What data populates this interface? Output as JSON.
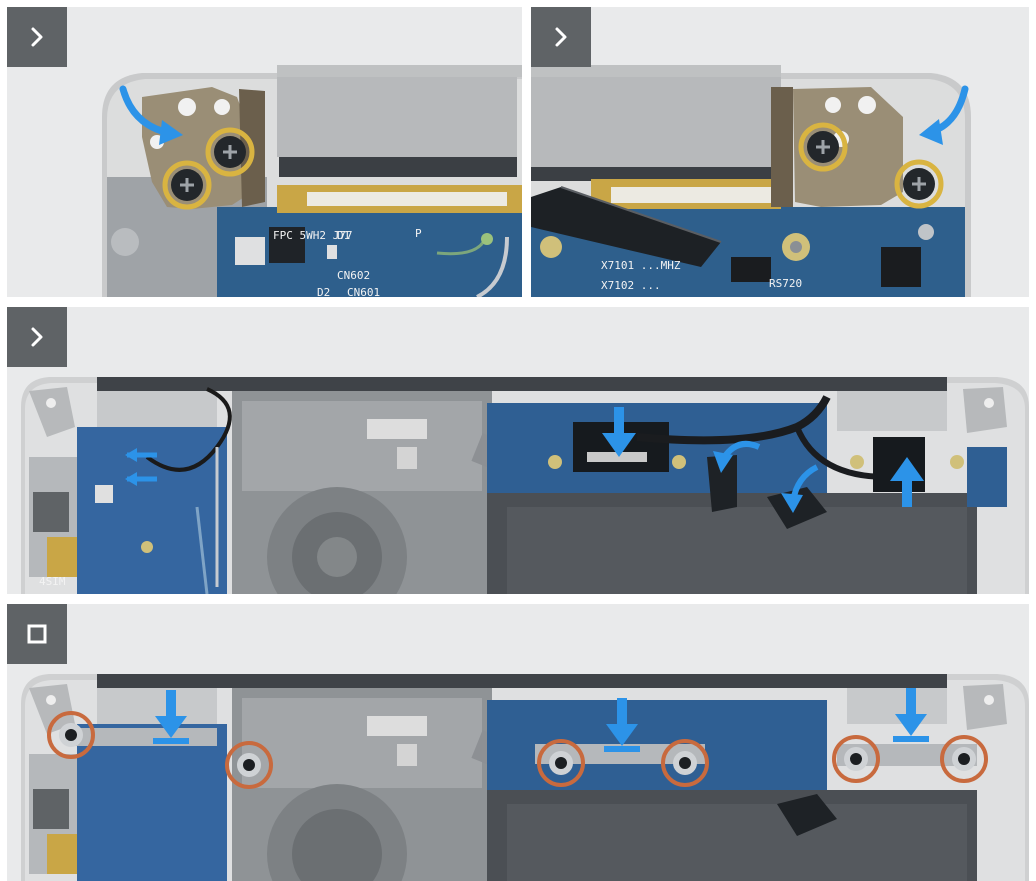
{
  "steps": [
    {
      "badge_icon": "chevron-right-icon"
    },
    {
      "badge_icon": "chevron-right-icon"
    },
    {
      "badge_icon": "chevron-right-icon"
    },
    {
      "badge_icon": "stop-square-icon"
    }
  ],
  "board_labels": {
    "d1": "D1",
    "p": "P",
    "cn602": "CN602",
    "d2": "D2",
    "cn601": "CN601",
    "chip_code": "X7101 ...MHZ",
    "chip_code_2": "X7102 ...",
    "ram": "RS720",
    "sim": "4SIM",
    "fpc": "FPC 5WH2 J77"
  },
  "colors": {
    "chassis": "#d9dadb",
    "board": "#2b5d8a",
    "hinge": "#9a8e76",
    "callout_gold": "#d9b441",
    "callout_orange": "#c86a3e",
    "arrow_blue": "#2c93e8",
    "badge": "#5f6366"
  }
}
